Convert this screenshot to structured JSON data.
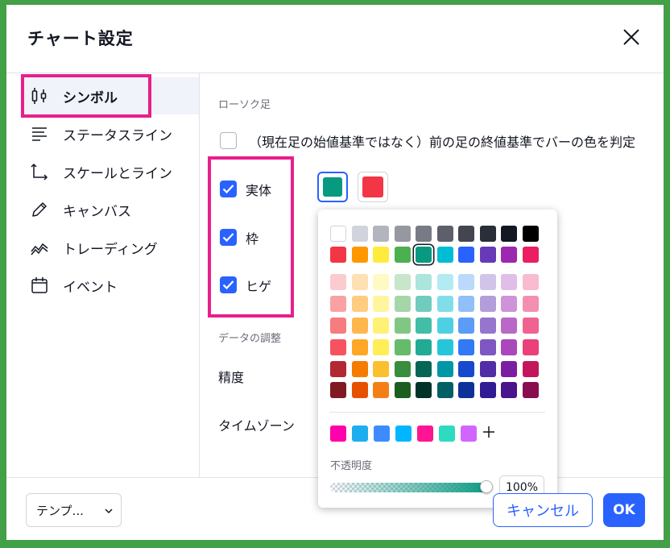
{
  "dialog": {
    "title": "チャート設定"
  },
  "sidebar": {
    "items": [
      {
        "label": "シンボル",
        "icon": "candles-icon",
        "active": true
      },
      {
        "label": "ステータスライン",
        "icon": "status-line-icon"
      },
      {
        "label": "スケールとライン",
        "icon": "scales-icon"
      },
      {
        "label": "キャンバス",
        "icon": "pencil-icon"
      },
      {
        "label": "トレーディング",
        "icon": "trading-icon"
      },
      {
        "label": "イベント",
        "icon": "calendar-icon"
      }
    ]
  },
  "candles": {
    "section_label": "ローソク足",
    "prev_close_label": "（現在足の始値基準ではなく）前の足の終値基準でバーの色を判定",
    "prev_close_checked": false,
    "body_label": "実体",
    "body_checked": true,
    "border_label": "枠",
    "border_checked": true,
    "wick_label": "ヒゲ",
    "wick_checked": true,
    "up_color": "#089981",
    "down_color": "#F23645"
  },
  "data_adjust": {
    "section_label": "データの調整",
    "precision_label": "精度",
    "timezone_label": "タイムゾーン"
  },
  "color_picker": {
    "rows": [
      [
        "#FFFFFF",
        "#D1D4DC",
        "#B2B5BE",
        "#9598A1",
        "#787B86",
        "#5D606B",
        "#434651",
        "#2A2E39",
        "#131722",
        "#000000"
      ],
      [
        "#F23645",
        "#FF9800",
        "#FFEB3B",
        "#4CAF50",
        "#089981",
        "#00BCD4",
        "#2962FF",
        "#673AB7",
        "#9C27B0",
        "#E91E63"
      ],
      [
        "#FCCBCD",
        "#FFE0B2",
        "#FFF9C4",
        "#C8E6C9",
        "#ACE5DC",
        "#B2EBF2",
        "#BBD9FB",
        "#D1C4E9",
        "#E1BEE7",
        "#F8BBD0"
      ],
      [
        "#FAA1A4",
        "#FFCC80",
        "#FFF59D",
        "#A5D6A7",
        "#70CCBD",
        "#80DEEA",
        "#90BFF9",
        "#B39DDB",
        "#CE93D8",
        "#F48FB1"
      ],
      [
        "#F77C80",
        "#FFB74D",
        "#FFF176",
        "#81C784",
        "#42BDA8",
        "#4DD0E1",
        "#5B9CF6",
        "#9575CD",
        "#BA68C8",
        "#F06292"
      ],
      [
        "#F7525F",
        "#FFA726",
        "#FFEE58",
        "#66BB6A",
        "#22AB94",
        "#26C6DA",
        "#3179F5",
        "#7E57C2",
        "#AB47BC",
        "#EC407A"
      ],
      [
        "#B22833",
        "#F57C00",
        "#FBC02D",
        "#388E3C",
        "#056656",
        "#0097A7",
        "#1848CC",
        "#512DA8",
        "#7B1FA2",
        "#C2185B"
      ],
      [
        "#801922",
        "#E65100",
        "#F57F17",
        "#1B5E20",
        "#00332A",
        "#006064",
        "#0C3299",
        "#311B92",
        "#4A148C",
        "#880E4F"
      ]
    ],
    "selected_color": "#089981",
    "custom_colors": [
      "#FF00AA",
      "#1EAEF0",
      "#3D8BFF",
      "#00B6FF",
      "#FF1493",
      "#2EDBC0",
      "#D066FF"
    ],
    "add_icon": "plus-icon",
    "opacity_label": "不透明度",
    "opacity_value": "100%",
    "opacity_percent": 100
  },
  "footer": {
    "template_label": "テンプ...",
    "cancel_label": "キャンセル",
    "ok_label": "OK"
  },
  "colors": {
    "accent": "#2962FF",
    "highlight": "#E91E8C",
    "frame": "#43A047"
  }
}
